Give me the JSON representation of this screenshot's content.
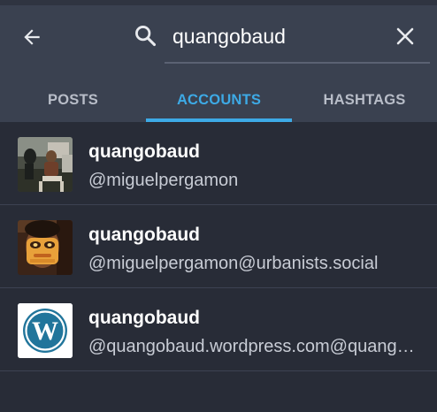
{
  "header": {
    "back_icon": "arrow-left-icon",
    "search_icon": "search-icon",
    "clear_icon": "close-icon",
    "search_query": "quangobaud"
  },
  "tabs": [
    {
      "label": "POSTS",
      "active": false
    },
    {
      "label": "ACCOUNTS",
      "active": true
    },
    {
      "label": "HASHTAGS",
      "active": false
    }
  ],
  "accounts": [
    {
      "display_name": "quangobaud",
      "handle": "@miguelpergamon"
    },
    {
      "display_name": "quangobaud",
      "handle": "@miguelpergamon@urbanists.social"
    },
    {
      "display_name": "quangobaud",
      "handle": "@quangobaud.wordpress.com@quangobaud.wordpress.com"
    }
  ],
  "colors": {
    "header_bg": "#3a4150",
    "list_bg": "#282c37",
    "accent": "#3daae6",
    "inactive_tab": "#b8bdc8"
  }
}
